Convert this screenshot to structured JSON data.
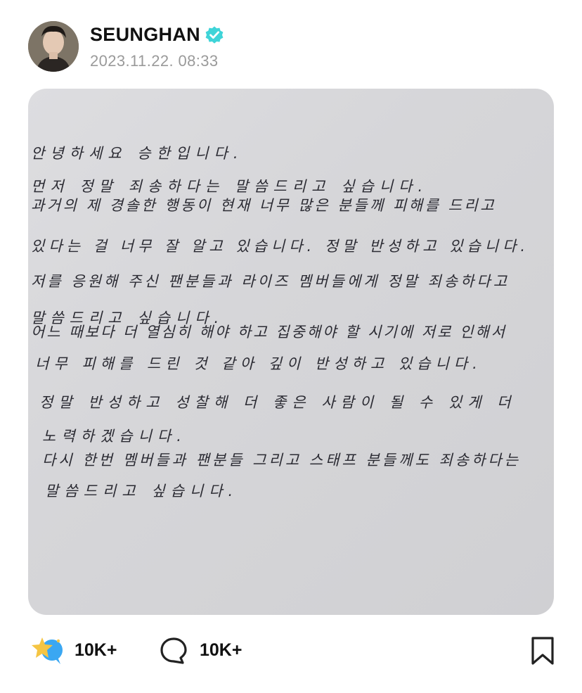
{
  "post": {
    "author": {
      "name": "SEUNGHAN",
      "verified": true,
      "avatar_icon": "profile-photo"
    },
    "timestamp": "2023.11.22. 08:33",
    "letter": {
      "lines": [
        "안녕하세요 승한입니다.",
        "먼저 정말 죄송하다는 말씀드리고 싶습니다.",
        "과거의 제 경솔한 행동이 현재 너무 많은 분들께 피해를 드리고",
        "있다는 걸 너무 잘 알고 있습니다. 정말 반성하고 있습니다.",
        "저를 응원해 주신 팬분들과 라이즈 멤버들에게 정말 죄송하다고",
        "말씀드리고 싶습니다.",
        "어느 때보다 더 열심히 해야 하고 집중해야 할 시기에 저로 인해서",
        "너무 피해를 드린 것 같아 깊이 반성하고 있습니다.",
        "정말 반성하고 성찰해 더 좋은 사람이 될 수 있게 더",
        "노력하겠습니다.",
        "다시 한번 멤버들과 팬분들 그리고 스태프 분들께도 죄송하다는",
        "말씀드리고 싶습니다."
      ]
    },
    "reactions": {
      "likes": "10K+",
      "comments": "10K+",
      "like_icon": "star-sparkle-icon",
      "comment_icon": "speech-bubble-icon",
      "bookmark_icon": "bookmark-icon"
    }
  },
  "colors": {
    "verified": "#3fd4d8",
    "timestamp": "#9a9a9a",
    "like_star": "#f5c543",
    "like_bubble": "#3aa7f2"
  }
}
